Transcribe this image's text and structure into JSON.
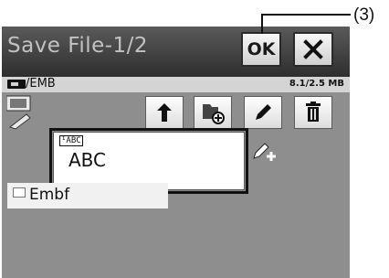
{
  "window": {
    "title": "Save File-1/2"
  },
  "titlebar": {
    "ok_label": "OK",
    "close_icon": "close-x-icon"
  },
  "pathbar": {
    "path": "/EMB",
    "storage": "8.1/2.5 MB",
    "drive_icon": "storage-drive-icon"
  },
  "toolbar": {
    "left_icon": "pen-tablet-icon",
    "buttons": [
      {
        "icon": "back-up-arrow-icon"
      },
      {
        "icon": "new-folder-icon"
      },
      {
        "icon": "pencil-edit-icon"
      },
      {
        "icon": "trash-icon"
      }
    ],
    "edit_plus_icon": "pencil-add-icon"
  },
  "input": {
    "tag": "¹ABC",
    "value": "ABC"
  },
  "files": [
    {
      "name": "Embf",
      "icon": "file-icon"
    }
  ],
  "annotation": {
    "label": "(3)"
  },
  "colors": {
    "screen_bg": "#8e8e8e",
    "titlebar_dark": "#2e2e2e",
    "title_text": "#c2c2c2",
    "pathbar_bg": "#d4d4d4"
  }
}
